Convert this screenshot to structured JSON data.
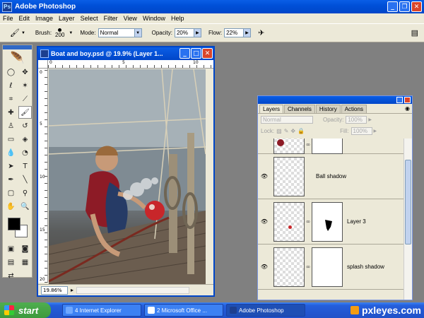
{
  "app": {
    "title": "Adobe Photoshop"
  },
  "menu": [
    "File",
    "Edit",
    "Image",
    "Layer",
    "Select",
    "Filter",
    "View",
    "Window",
    "Help"
  ],
  "options": {
    "brush_label": "Brush:",
    "brush_size": "200",
    "mode_label": "Mode:",
    "mode_value": "Normal",
    "opacity_label": "Opacity:",
    "opacity_value": "20%",
    "flow_label": "Flow:",
    "flow_value": "22%"
  },
  "document": {
    "title": "Boat and boy.psd @ 19.9% (Layer 1...",
    "zoom": "19.86%",
    "ruler_top": [
      "0",
      "5",
      "10"
    ],
    "ruler_left": [
      "0",
      "5",
      "10",
      "15",
      "20"
    ]
  },
  "layers_panel": {
    "tabs": [
      "Layers",
      "Channels",
      "History",
      "Actions"
    ],
    "blend_mode": "Normal",
    "opacity_label": "Opacity:",
    "opacity_value": "100%",
    "lock_label": "Lock:",
    "fill_label": "Fill:",
    "fill_value": "100%",
    "layers": [
      {
        "name": ""
      },
      {
        "name": "Ball shadow"
      },
      {
        "name": "Layer 3"
      },
      {
        "name": "splash shadow"
      }
    ]
  },
  "taskbar": {
    "start": "start",
    "tasks": [
      "4 Internet Explorer",
      "2 Microsoft Office ...",
      "Adobe Photoshop"
    ]
  },
  "watermark": "pxleyes.com",
  "colors": {
    "xp_blue": "#0050d8",
    "xp_green": "#3c9a3c",
    "face": "#ece9d8"
  }
}
